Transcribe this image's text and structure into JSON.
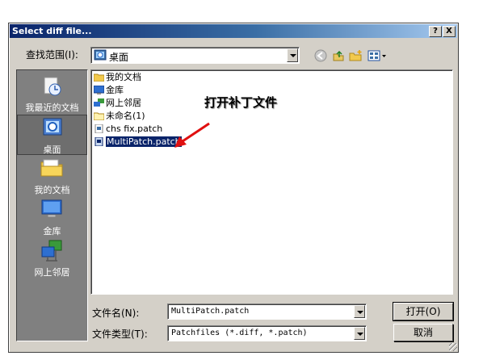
{
  "window": {
    "title": "Select diff file...",
    "help_btn": "?",
    "close_btn": "X"
  },
  "lookin": {
    "label": "查找范围(I):",
    "value": "桌面"
  },
  "places": [
    {
      "label": "我最近的文档",
      "icon": "recent-documents-icon"
    },
    {
      "label": "桌面",
      "icon": "desktop-icon"
    },
    {
      "label": "我的文档",
      "icon": "my-documents-icon"
    },
    {
      "label": "金库",
      "icon": "computer-icon"
    },
    {
      "label": "网上邻居",
      "icon": "network-places-icon"
    }
  ],
  "files": [
    {
      "name": "我的文档"
    },
    {
      "name": "金库"
    },
    {
      "name": "网上邻居"
    },
    {
      "name": "未命名(1)"
    },
    {
      "name": "chs fix.patch"
    },
    {
      "name": "MultiPatch.patch"
    }
  ],
  "annotation": {
    "text": "打开补丁文件",
    "color": "#e01010"
  },
  "filename": {
    "label": "文件名(N):",
    "value": "MultiPatch.patch"
  },
  "filetype": {
    "label": "文件类型(T):",
    "value": "Patchfiles (*.diff, *.patch)"
  },
  "buttons": {
    "open": "打开(O)",
    "cancel": "取消"
  },
  "colors": {
    "title_start": "#0a246a",
    "title_end": "#a6caf0",
    "selection": "#0a246a",
    "face": "#d4d0c8"
  }
}
